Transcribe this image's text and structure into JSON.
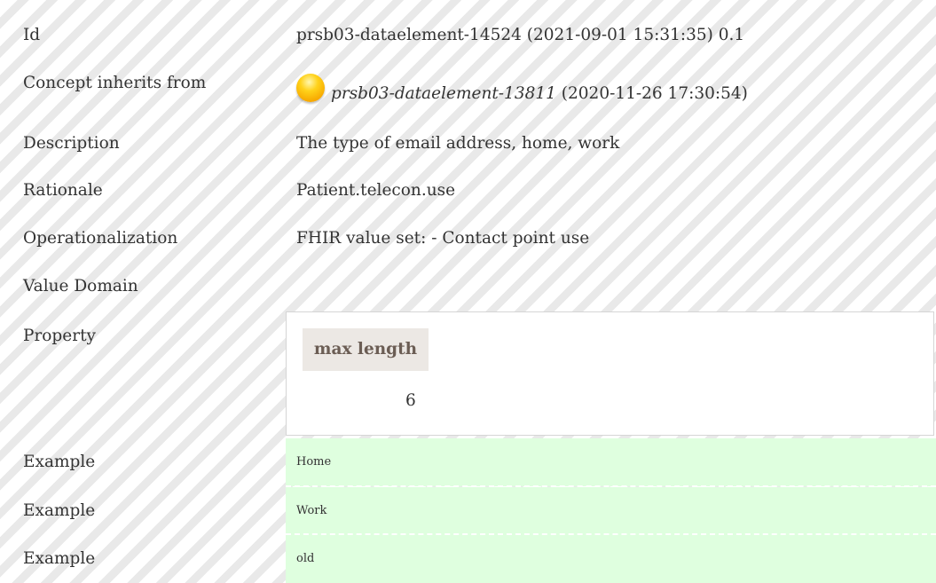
{
  "rows": {
    "id": {
      "label": "Id",
      "value": "prsb03-dataelement-14524 (2021-09-01 15:31:35) 0.1"
    },
    "inherits": {
      "label": "Concept inherits from",
      "link": "prsb03-dataelement-13811",
      "date": " (2020-11-26 17:30:54)",
      "icon": "status-orb-icon"
    },
    "description": {
      "label": "Description",
      "value": "The type of email address, home, work"
    },
    "rationale": {
      "label": "Rationale",
      "value": "Patient.telecon.use"
    },
    "operationalization": {
      "label": "Operationalization",
      "value": "FHIR value set: - Contact point use"
    },
    "value_domain": {
      "label": "Value Domain"
    },
    "property": {
      "label": "Property",
      "header": "max length",
      "value": "6"
    }
  },
  "examples": [
    {
      "label": "Example",
      "value": "Home"
    },
    {
      "label": "Example",
      "value": "Work"
    },
    {
      "label": "Example",
      "value": "old"
    }
  ],
  "colors": {
    "example_bg": "#dfffdf",
    "property_header_bg": "#ece8e4",
    "orb": "#ffc800"
  }
}
